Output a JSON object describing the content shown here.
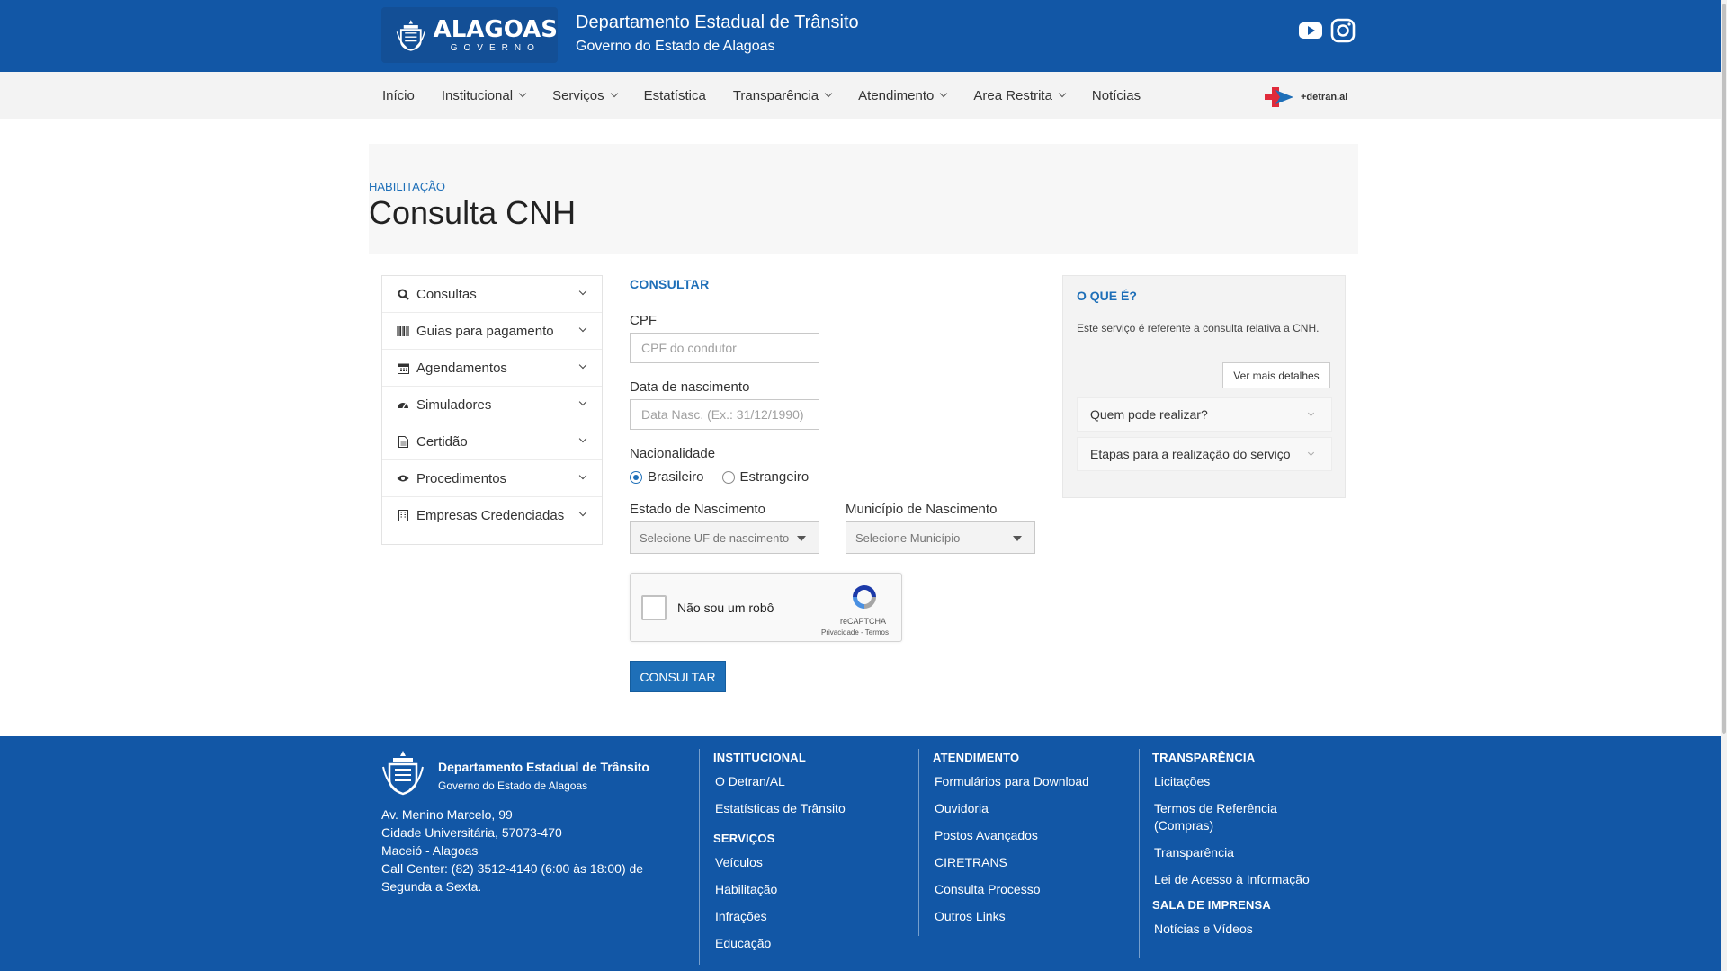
{
  "header": {
    "logo_text": "ALAGOAS",
    "logo_sub": "GOVERNO",
    "title": "Departamento Estadual de Trânsito",
    "subtitle": "Governo do Estado de Alagoas",
    "social": [
      "youtube-icon",
      "instagram-icon"
    ]
  },
  "nav": {
    "items": [
      {
        "label": "Início",
        "dropdown": false
      },
      {
        "label": "Institucional",
        "dropdown": true
      },
      {
        "label": "Serviços",
        "dropdown": true
      },
      {
        "label": "Estatística",
        "dropdown": false
      },
      {
        "label": "Transparência",
        "dropdown": true
      },
      {
        "label": "Atendimento",
        "dropdown": true
      },
      {
        "label": "Area Restrita",
        "dropdown": true
      },
      {
        "label": "Notícias",
        "dropdown": false
      }
    ],
    "app_logo_text": "+detran.al"
  },
  "page": {
    "breadcrumb": "HABILITAÇÃO",
    "title": "Consulta CNH"
  },
  "sidebar": {
    "items": [
      {
        "label": "Consultas",
        "icon": "search-icon"
      },
      {
        "label": "Guias para pagamento",
        "icon": "barcode-icon"
      },
      {
        "label": "Agendamentos",
        "icon": "calendar-icon"
      },
      {
        "label": "Simuladores",
        "icon": "dashboard-icon"
      },
      {
        "label": "Certidão",
        "icon": "document-icon"
      },
      {
        "label": "Procedimentos",
        "icon": "eye-icon"
      },
      {
        "label": "Empresas Credenciadas",
        "icon": "building-icon"
      }
    ]
  },
  "form": {
    "heading": "CONSULTAR",
    "cpf_label": "CPF",
    "cpf_placeholder": "CPF do condutor",
    "dob_label": "Data de nascimento",
    "dob_placeholder": "Data Nasc. (Ex.: 31/12/1990)",
    "nationality_label": "Nacionalidade",
    "nationality_options": [
      "Brasileiro",
      "Estrangeiro"
    ],
    "nationality_selected": "Brasileiro",
    "state_label": "Estado de Nascimento",
    "state_placeholder": "Selecione UF de nascimento",
    "city_label": "Município de Nascimento",
    "city_placeholder": "Selecione Município",
    "captcha_text": "Não sou um robô",
    "captcha_brand": "reCAPTCHA",
    "captcha_links": "Privacidade - Termos",
    "submit_label": "CONSULTAR"
  },
  "info": {
    "title": "O QUE É?",
    "text": "Este serviço é referente a consulta relativa a CNH.",
    "more_label": "Ver mais detalhes",
    "accordions": [
      "Quem pode realizar?",
      "Etapas para a realização do serviço"
    ]
  },
  "footer": {
    "org": "Departamento Estadual de Trânsito",
    "gov": "Governo do Estado de Alagoas",
    "address": [
      "Av. Menino Marcelo, 99",
      "Cidade Universitária, 57073-470",
      "Maceió - Alagoas",
      "Call Center: (82) 3512-4140 (6:00 às 18:00) de Segunda a Sexta."
    ],
    "institucional": {
      "title": "INSTITUCIONAL",
      "links": [
        "O Detran/AL",
        "Estatísticas de Trânsito"
      ]
    },
    "servicos": {
      "title": "SERVIÇOS",
      "links": [
        "Veículos",
        "Habilitação",
        "Infrações",
        "Educação"
      ]
    },
    "atendimento": {
      "title": "ATENDIMENTO",
      "links": [
        "Formulários para Download",
        "Ouvidoria",
        "Postos Avançados",
        "CIRETRANS",
        "Consulta Processo",
        "Outros Links"
      ]
    },
    "transparencia": {
      "title": "TRANSPARÊNCIA",
      "links": [
        "Licitações",
        "Termos de Referência (Compras)",
        "Transparência",
        "Lei de Acesso à Informação"
      ]
    },
    "imprensa": {
      "title": "SALA DE IMPRENSA",
      "links": [
        "Notícias e Vídeos"
      ]
    }
  },
  "colors": {
    "brand_blue": "#1257a6",
    "accent_blue": "#1e6fb8",
    "nav_bg": "#f3f3f3"
  }
}
